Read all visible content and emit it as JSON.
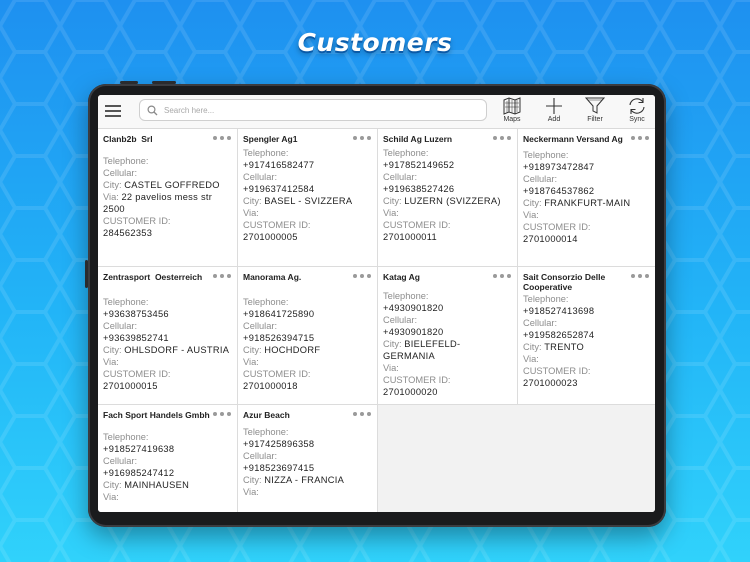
{
  "headline": "Customers",
  "search": {
    "placeholder": "Search here..."
  },
  "toolbar": {
    "maps_label": "Maps",
    "add_label": "Add",
    "filter_label": "Filter",
    "sync_label": "Sync"
  },
  "labels": {
    "telephone": "Telephone:",
    "cellular": "Cellular:",
    "city": "City:",
    "via": "Via:",
    "customer_id": "CUSTOMER ID:"
  },
  "customers": [
    {
      "name": "Clanb2b  Srl",
      "telephone": "",
      "cellular": "",
      "city": "CASTEL GOFFREDO",
      "via": "22 pavelios mess str 2500",
      "customer_id": "284562353"
    },
    {
      "name": "Spengler Ag1",
      "telephone": "+917416582477",
      "cellular": "+919637412584",
      "city": "BASEL - SVIZZERA",
      "via": "",
      "customer_id": "2701000005"
    },
    {
      "name": "Schild Ag Luzern",
      "telephone": "+917852149652",
      "cellular": "+919638527426",
      "city": "LUZERN (SVIZZERA)",
      "via": "",
      "customer_id": "2701000011"
    },
    {
      "name": "Neckermann Versand Ag",
      "telephone": "+918973472847",
      "cellular": "+918764537862",
      "city": "FRANKFURT-MAIN",
      "via": "",
      "customer_id": "2701000014"
    },
    {
      "name": "Zentrasport  Oesterreich",
      "telephone": "+93638753456",
      "cellular": "+93639852741",
      "city": "OHLSDORF - AUSTRIA",
      "via": "",
      "customer_id": "2701000015"
    },
    {
      "name": "Manorama Ag.",
      "telephone": "+918641725890",
      "cellular": "+918526394715",
      "city": "HOCHDORF",
      "via": "",
      "customer_id": "2701000018"
    },
    {
      "name": "Katag Ag",
      "telephone": "+4930901820",
      "cellular": "+4930901820",
      "city": "BIELEFELD-GERMANIA",
      "via": "",
      "customer_id": "2701000020"
    },
    {
      "name": "Sait Consorzio Delle Cooperative",
      "telephone": "+918527413698",
      "cellular": "+919582652874",
      "city": "TRENTO",
      "via": "",
      "customer_id": "2701000023"
    },
    {
      "name": "Fach Sport Handels Gmbh",
      "telephone": "+918527419638",
      "cellular": "+916985247412",
      "city": "MAINHAUSEN",
      "via": "",
      "customer_id": ""
    },
    {
      "name": "Azur Beach",
      "telephone": "+917425896358",
      "cellular": "+918523697415",
      "city": "NIZZA - FRANCIA",
      "via": "",
      "customer_id": ""
    }
  ],
  "colors": {
    "accent": "#1e90f0",
    "card_border": "#dcdcdc",
    "label_gray": "#8d8d8d"
  },
  "icons": [
    "menu-icon",
    "search-icon",
    "map-icon",
    "plus-icon",
    "funnel-icon",
    "sync-icon",
    "more-dots-icon"
  ]
}
